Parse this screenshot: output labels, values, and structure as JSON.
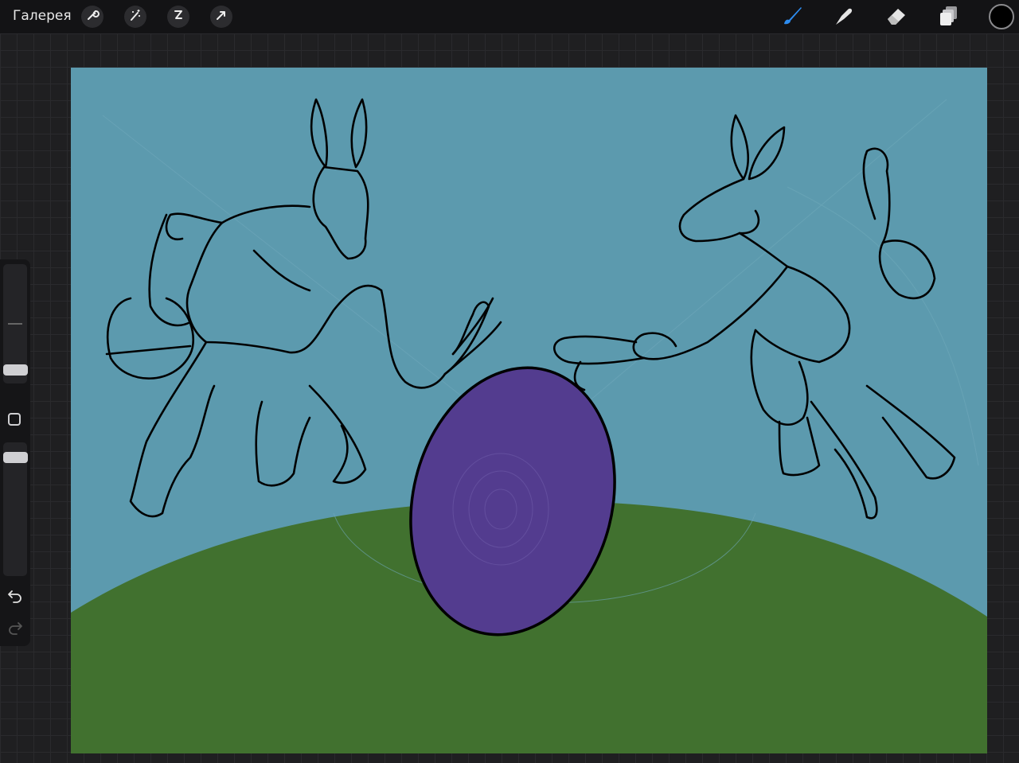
{
  "toolbar": {
    "gallery_label": "Галерея",
    "left_tools": [
      "wrench-icon",
      "magic-wand-icon",
      "selection-s-icon",
      "transform-arrow-icon"
    ],
    "right_tools": [
      "brush-icon",
      "smudge-icon",
      "eraser-icon",
      "layers-icon"
    ],
    "active_tool": "brush",
    "current_color": "#000000"
  },
  "sidebar": {
    "brush_size": 0.1,
    "opacity": 0.9,
    "modify_button": "square-icon",
    "undo": "undo-icon",
    "redo": "redo-icon"
  },
  "canvas": {
    "sky_color": "#5c9aae",
    "grass_color": "#41712f",
    "egg_color": "#533c8f",
    "line_color": "#000000"
  }
}
